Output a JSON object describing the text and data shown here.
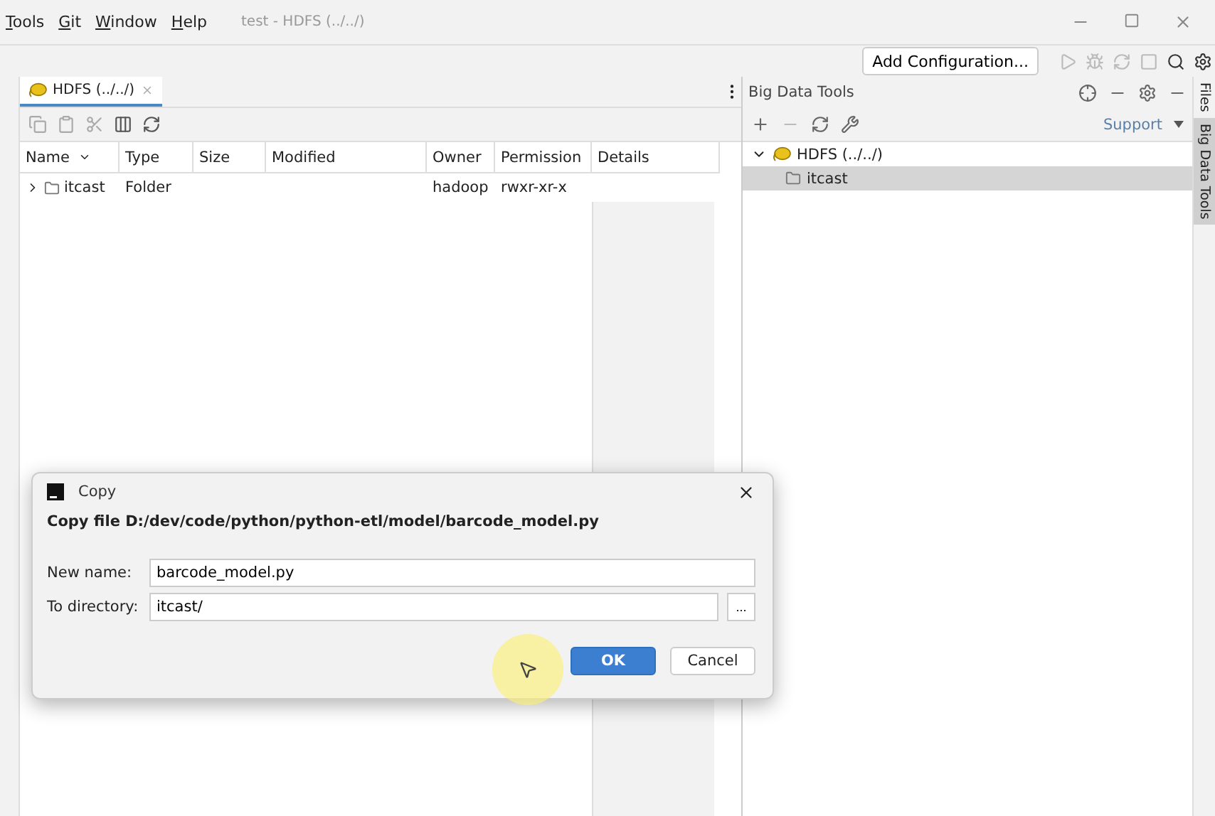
{
  "menu": [
    {
      "label": "Tools"
    },
    {
      "label": "Git"
    },
    {
      "label": "Window"
    },
    {
      "label": "Help"
    }
  ],
  "window": {
    "title": "test - HDFS (../../)"
  },
  "toolbar": {
    "run_config": "Add Configuration..."
  },
  "left_panel": {
    "tab": {
      "label": "HDFS (../../)",
      "selected": true
    },
    "columns": [
      {
        "label": "Name",
        "sorted": true
      },
      {
        "label": "Type",
        "sorted": false
      },
      {
        "label": "Size",
        "sorted": false
      },
      {
        "label": "Modified",
        "sorted": false
      },
      {
        "label": "Owner",
        "sorted": false
      },
      {
        "label": "Permission",
        "sorted": false
      },
      {
        "label": "Details",
        "sorted": false
      }
    ],
    "rows": [
      {
        "name": "itcast",
        "type": "Folder",
        "owner": "hadoop",
        "permission": "rwxr-xr-x"
      }
    ]
  },
  "right_panel": {
    "title": "Big Data Tools",
    "support": "Support",
    "tree": [
      {
        "label": "HDFS (../../)",
        "expanded": true,
        "selected": false,
        "children": [
          {
            "label": "itcast",
            "selected": true
          }
        ]
      }
    ]
  },
  "side_tabs": [
    {
      "label": "Files",
      "selected": false
    },
    {
      "label": "Big Data Tools",
      "selected": true
    }
  ],
  "dialog": {
    "title": "Copy",
    "heading": "Copy file D:/dev/code/python/python-etl/model/barcode_model.py",
    "fields": [
      {
        "label": "New name:",
        "value": "barcode_model.py",
        "browse": false
      },
      {
        "label": "To directory:",
        "value": "itcast/",
        "browse": true
      }
    ],
    "browse_label": "...",
    "buttons": [
      {
        "label": "OK",
        "default": true
      },
      {
        "label": "Cancel",
        "default": false
      }
    ]
  }
}
